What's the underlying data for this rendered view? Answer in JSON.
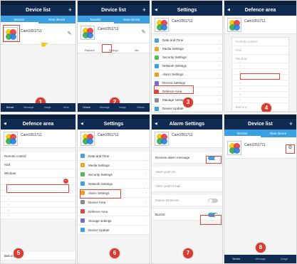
{
  "common": {
    "device_list_title": "Device list",
    "settings_title": "Settings",
    "defence_area_title": "Defence area",
    "alarm_settings_title": "Alarm Settings",
    "camera_name": "Cam1051711",
    "tab_monitor": "Monitor",
    "tab_new_device": "New device",
    "back": "◀"
  },
  "panel2": {
    "toolbar_playback": "Playback",
    "toolbar_setting": "Settings",
    "toolbar_alarm": "Ala..."
  },
  "settings_menu": [
    {
      "label": "Date and Time",
      "color": "#4aa0dc"
    },
    {
      "label": "Media Settings",
      "color": "#f3a32a"
    },
    {
      "label": "Security Settings",
      "color": "#5cb85c"
    },
    {
      "label": "Network Settings",
      "color": "#3aa0e2"
    },
    {
      "label": "Alarm Settings",
      "color": "#e8a21c"
    },
    {
      "label": "Record Settings",
      "color": "#7a6ad8"
    },
    {
      "label": "Defence Area",
      "color": "#e0473b"
    },
    {
      "label": "Manage settings",
      "color": "#8b8b8b"
    },
    {
      "label": "Device Update",
      "color": "#3aa0e2"
    }
  ],
  "settings_menu_b": [
    {
      "label": "Date and Time",
      "color": "#4aa0dc"
    },
    {
      "label": "Media Settings",
      "color": "#f3a32a"
    },
    {
      "label": "Security Settings",
      "color": "#5cb85c"
    },
    {
      "label": "Network Settings",
      "color": "#3aa0e2"
    },
    {
      "label": "Alarm Settings",
      "color": "#e8a21c"
    },
    {
      "label": "Device Area",
      "color": "#8b8b8b"
    },
    {
      "label": "Defence Area",
      "color": "#e0473b"
    },
    {
      "label": "Storage settings",
      "color": "#7a6ad8"
    },
    {
      "label": "Device Update",
      "color": "#3aa0e2"
    }
  ],
  "defence": {
    "remote_control": "Remote control",
    "hall": "Hall",
    "window": "Window",
    "balcony": "Balcony"
  },
  "alarm": {
    "receive_alarm_message": "Receive alarm message",
    "alarm_push_id": "Alarm push ID",
    "alarm_push_email": "Alarm push Email",
    "motion_detection": "Motion Detection",
    "buzzer": "Buzzer"
  },
  "bottom_nav": [
    "Device",
    "Message",
    "Image",
    "Others",
    "More"
  ],
  "step_numbers": [
    "1",
    "2",
    "3",
    "4",
    "5",
    "6",
    "7",
    "8"
  ],
  "colors": {
    "highlight": "#e0473b",
    "accent": "#3aa0e2",
    "titlebar": "#0f2b52"
  }
}
